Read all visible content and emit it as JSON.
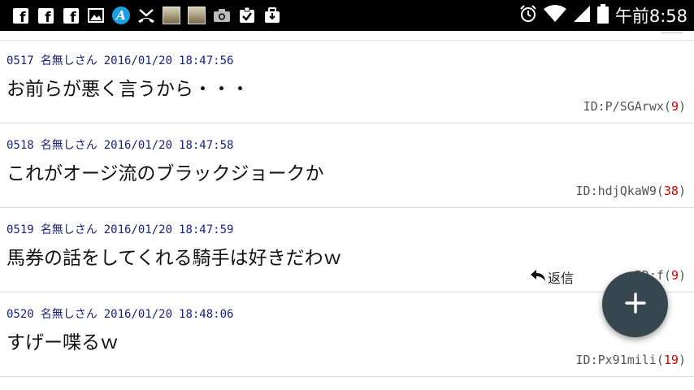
{
  "status_bar": {
    "time": "午前8:58",
    "left_icons": [
      "facebook-icon",
      "facebook-icon",
      "facebook-icon",
      "gallery-icon",
      "a-app-icon",
      "missed-call-icon",
      "game-app-icon",
      "game-app-icon",
      "camera-icon",
      "clipboard-check-icon",
      "briefcase-icon"
    ],
    "right_icons": [
      "alarm-icon",
      "wifi-icon",
      "signal-icon",
      "battery-icon"
    ]
  },
  "posts": [
    {
      "number": "0517",
      "name": "名無しさん",
      "date": "2016/01/20",
      "time": "18:47:56",
      "text": "お前らが悪く言うから・・・",
      "id": "ID:P/SGArwx",
      "count": "9"
    },
    {
      "number": "0518",
      "name": "名無しさん",
      "date": "2016/01/20",
      "time": "18:47:58",
      "text": "これがオージ流のブラックジョークか",
      "id": "ID:hdjQkaW9",
      "count": "38"
    },
    {
      "number": "0519",
      "name": "名無しさん",
      "date": "2016/01/20",
      "time": "18:47:59",
      "text": "馬券の話をしてくれる騎手は好きだわｗ",
      "id": "ID:f",
      "count": "9",
      "reply_label": "返信"
    },
    {
      "number": "0520",
      "name": "名無しさん",
      "date": "2016/01/20",
      "time": "18:48:06",
      "text": "すげー喋るｗ",
      "id": "ID:Px91mili",
      "count": "19"
    }
  ],
  "fab": {
    "icon": "plus-icon"
  },
  "colors": {
    "header_text": "#1a237e",
    "count_red": "#d50000",
    "fab": "#37474f",
    "divider": "#dcdcdc"
  }
}
